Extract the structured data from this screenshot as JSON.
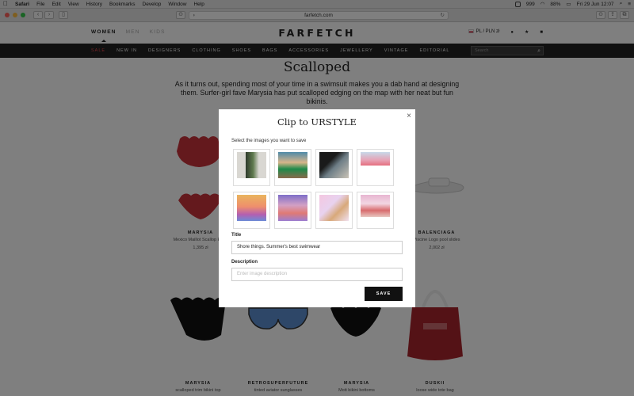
{
  "menubar": {
    "app": "Safari",
    "items": [
      "File",
      "Edit",
      "View",
      "History",
      "Bookmarks",
      "Develop",
      "Window",
      "Help"
    ],
    "battery": "88%",
    "count": "999",
    "datetime": "Fri 29 Jun  12:07"
  },
  "browser": {
    "url": "farfetch.com"
  },
  "header": {
    "genders": [
      "WOMEN",
      "MEN",
      "KIDS"
    ],
    "logo": "FARFETCH",
    "locale": "PL / PLN zł"
  },
  "nav": {
    "items": [
      "SALE",
      "NEW IN",
      "DESIGNERS",
      "CLOTHING",
      "SHOES",
      "BAGS",
      "ACCESSORIES",
      "JEWELLERY",
      "VINTAGE",
      "EDITORIAL"
    ],
    "search_placeholder": "Search"
  },
  "article": {
    "title": "Scalloped",
    "description": "As it turns out, spending most of your time in a swimsuit makes you a dab hand at designing them. Surfer-girl fave Marysia has put scalloped edging on the map with her neat but fun bikinis."
  },
  "products": [
    {
      "brand": "MARYSIA",
      "name": "Mexico Maillot Scallop Edge",
      "price": "1,395 zł"
    },
    {
      "brand": "BALENCIAGA",
      "name": "Piscine Logo pool slides",
      "price": "2,002 zł"
    },
    {
      "brand": "MARYSIA",
      "name": "scalloped trim bikini top",
      "price": ""
    },
    {
      "brand": "RETROSUPERFUTURE",
      "name": "tinted aviator sunglasses",
      "price": ""
    },
    {
      "brand": "MARYSIA",
      "name": "Mott bikini bottoms",
      "price": ""
    },
    {
      "brand": "DUSKII",
      "name": "loose wide tote bag",
      "price": ""
    }
  ],
  "modal": {
    "title": "Clip to URSTYLE",
    "close": "×",
    "hint": "Select the images you want to save",
    "title_label": "Title",
    "title_value": "Shore things. Summer's best swimwear",
    "description_label": "Description",
    "description_placeholder": "Enter image description",
    "save_label": "SAVE"
  },
  "colors": {
    "sale": "#e8484e",
    "nav_bg": "#222222",
    "overlay": "rgba(0,0,0,0.5)",
    "red_bikini": "#c8323a"
  }
}
